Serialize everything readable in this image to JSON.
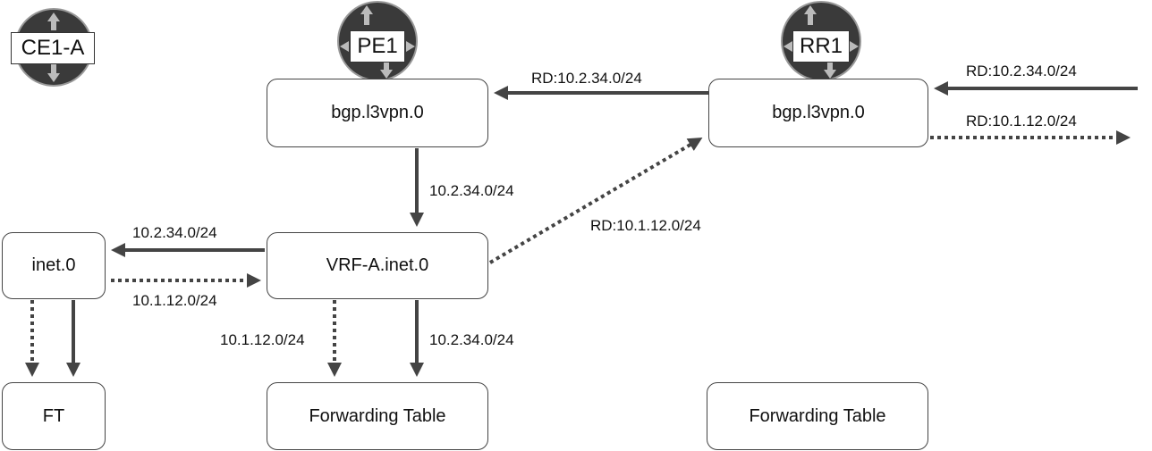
{
  "routers": {
    "ce": "CE1-A",
    "pe": "PE1",
    "rr": "RR1"
  },
  "tables": {
    "pe_bgp": "bgp.l3vpn.0",
    "rr_bgp": "bgp.l3vpn.0",
    "ce_inet": "inet.0",
    "pe_vrf": "VRF-A.inet.0",
    "ce_ft": "FT",
    "pe_ft": "Forwarding Table",
    "rr_ft": "Forwarding Table"
  },
  "labels": {
    "rr_to_pe": "RD:10.2.34.0/24",
    "in_to_rr": "RD:10.2.34.0/24",
    "rr_out": "RD:10.1.12.0/24",
    "bgp_to_vrf": "10.2.34.0/24",
    "vrf_to_rr": "RD:10.1.12.0/24",
    "vrf_to_inet": "10.2.34.0/24",
    "inet_to_vrf": "10.1.12.0/24",
    "vrf_ft_dotted": "10.1.12.0/24",
    "vrf_ft_solid": "10.2.34.0/24"
  },
  "colors": {
    "line": "#444444",
    "router": "#3a3a3a"
  }
}
